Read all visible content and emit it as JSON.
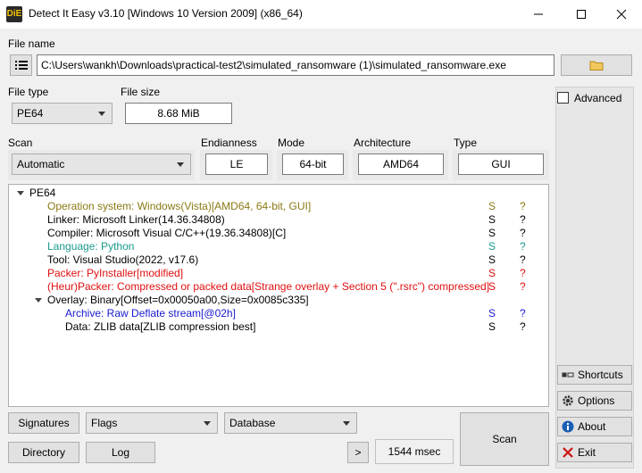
{
  "window": {
    "title": "Detect It Easy v3.10 [Windows 10 Version 2009] (x86_64)",
    "logo_text": "DiE"
  },
  "file": {
    "label": "File name",
    "path": "C:\\Users\\wankh\\Downloads\\practical-test2\\simulated_ransomware (1)\\simulated_ransomware.exe"
  },
  "file_type": {
    "label": "File type",
    "value": "PE64"
  },
  "file_size": {
    "label": "File size",
    "value": "8.68 MiB"
  },
  "advanced": {
    "label": "Advanced",
    "checked": false
  },
  "scan_mode": {
    "label": "Scan",
    "value": "Automatic"
  },
  "endianness": {
    "label": "Endianness",
    "value": "LE"
  },
  "mode": {
    "label": "Mode",
    "value": "64-bit"
  },
  "architecture": {
    "label": "Architecture",
    "value": "AMD64"
  },
  "type": {
    "label": "Type",
    "value": "GUI"
  },
  "colors": {
    "olive": "#8a7a14",
    "teal": "#1a9a8a",
    "red": "#e01010",
    "blue": "#1a1ad0",
    "black": "#000000"
  },
  "results": [
    {
      "text": "PE64",
      "s": "",
      "q": "",
      "color": "black",
      "indent": 1,
      "expander": true
    },
    {
      "text": "Operation system: Windows(Vista)[AMD64, 64-bit, GUI]",
      "s": "S",
      "q": "?",
      "color": "olive",
      "indent": 2
    },
    {
      "text": "Linker: Microsoft Linker(14.36.34808)",
      "s": "S",
      "q": "?",
      "color": "black",
      "indent": 2
    },
    {
      "text": "Compiler: Microsoft Visual C/C++(19.36.34808)[C]",
      "s": "S",
      "q": "?",
      "color": "black",
      "indent": 2
    },
    {
      "text": "Language: Python",
      "s": "S",
      "q": "?",
      "color": "teal",
      "indent": 2
    },
    {
      "text": "Tool: Visual Studio(2022, v17.6)",
      "s": "S",
      "q": "?",
      "color": "black",
      "indent": 2
    },
    {
      "text": "Packer: PyInstaller[modified]",
      "s": "S",
      "q": "?",
      "color": "red",
      "indent": 2
    },
    {
      "text": "(Heur)Packer: Compressed or packed data[Strange overlay + Section 5 (\".rsrc\") compressed]",
      "s": "S",
      "q": "?",
      "color": "red",
      "indent": 2
    },
    {
      "text": "Overlay: Binary[Offset=0x00050a00,Size=0x0085c335]",
      "s": "",
      "q": "",
      "color": "black",
      "indent": 2,
      "expander": true
    },
    {
      "text": "Archive: Raw Deflate stream[@02h]",
      "s": "S",
      "q": "?",
      "color": "blue",
      "indent": 3
    },
    {
      "text": "Data: ZLIB data[ZLIB compression best]",
      "s": "S",
      "q": "?",
      "color": "black",
      "indent": 3
    }
  ],
  "bottom": {
    "signatures": "Signatures",
    "flags": "Flags",
    "database": "Database",
    "directory": "Directory",
    "log": "Log",
    "more": ">",
    "time": "1544 msec",
    "scan": "Scan"
  },
  "side": {
    "shortcuts": "Shortcuts",
    "options": "Options",
    "about": "About",
    "exit": "Exit"
  }
}
